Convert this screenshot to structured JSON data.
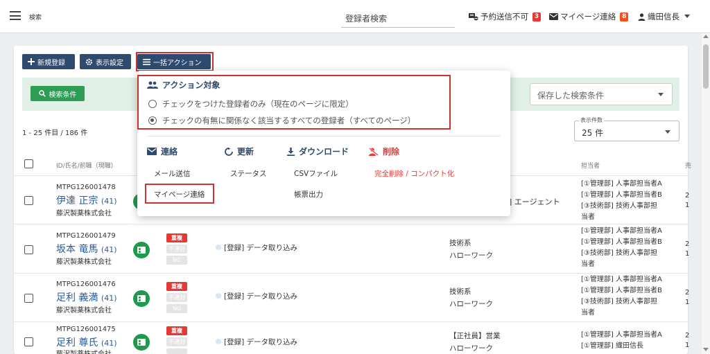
{
  "header": {
    "search_label": "検索",
    "search_input": "登録者検索",
    "send_unavailable": "予約送信不可",
    "send_unavailable_count": "3",
    "mypage_contact": "マイページ連絡",
    "mypage_contact_count": "8",
    "user_name": "織田信長"
  },
  "toolbar": {
    "new_button": "新規登録",
    "display_settings_button": "表示設定",
    "bulk_action_button": "一括アクション"
  },
  "filter": {
    "search_conditions_button": "検索条件",
    "saved_search_placeholder": "保存した検索条件"
  },
  "list": {
    "range_text": "1 - 25 件目 / 186 件",
    "per_page_label": "表示件数",
    "per_page_value": "25 件",
    "columns": {
      "id_name": "ID/氏名/前職（現職）",
      "owner": "担当者"
    },
    "rows": [
      {
        "id": "MTPG126001478",
        "name": "伊達 正宗",
        "age": "(41)",
        "company": "藤沢製薬株式会社",
        "agent": "] エージェント",
        "owners": [
          "[①管理部] 人事部担当者A",
          "[①管理部] 人事部担当者B",
          "[③技術部] 技術人事部担",
          "当者"
        ],
        "cut": [
          "2",
          "1"
        ]
      },
      {
        "id": "MTPG126001479",
        "name": "坂本 竜馬",
        "age": "(41)",
        "company": "藤沢製薬株式会社",
        "tags": [
          "重複",
          "不通封",
          "NG"
        ],
        "route": "[登録] データ取り込み",
        "media": [
          "技術系",
          "ハローワーク"
        ],
        "owners": [
          "[①管理部] 人事部担当者A",
          "[①管理部] 人事部担当者B",
          "[③技術部] 技術人事部担",
          "当者"
        ],
        "cut": [
          "2",
          "1"
        ]
      },
      {
        "id": "MTPG126001476",
        "name": "足利 義満",
        "age": "(41)",
        "company": "藤沢製薬株式会社",
        "tags": [
          "重複",
          "不通封",
          "NG"
        ],
        "route": "[登録] データ取り込み",
        "media": [
          "技術系",
          "ハローワーク"
        ],
        "owners": [
          "[①管理部] 人事部担当者A",
          "[①管理部] 人事部担当者B",
          "[③技術部] 技術人事部担",
          "当者"
        ],
        "cut": [
          "2",
          "1"
        ]
      },
      {
        "id": "MTPG126001475",
        "name": "足利 尊氏",
        "age": "(41)",
        "company": "藤沢製薬株式会社",
        "tags": [
          "重複",
          "不通封",
          "NG"
        ],
        "route": "[登録] データ取り込み",
        "media": [
          "【正社員】営業",
          "ハローワーク"
        ],
        "owners": [
          "[①管理部] 人事部担当者A",
          "[①管理部] 織田信長"
        ],
        "cut": [
          "2",
          "1"
        ]
      }
    ]
  },
  "dropdown": {
    "target_title": "アクション対象",
    "option_checked_only": "チェックをつけた登録者のみ（現在のページに限定）",
    "option_all": "チェックの有無に関係なく該当するすべての登録者（すべてのページ）",
    "categories": {
      "contact": {
        "title": "連絡",
        "items": [
          "メール送信",
          "マイページ連絡"
        ]
      },
      "update": {
        "title": "更新",
        "items": [
          "ステータス"
        ]
      },
      "download": {
        "title": "ダウンロード",
        "items": [
          "CSVファイル",
          "帳票出力"
        ]
      },
      "delete": {
        "title": "削除",
        "items": [
          "完全削除 / コンパクト化"
        ]
      }
    }
  },
  "colors": {
    "navy": "#2e4a6e",
    "green": "#2e9c52",
    "red": "#e53935",
    "highlight_box": "#d32f2f"
  }
}
